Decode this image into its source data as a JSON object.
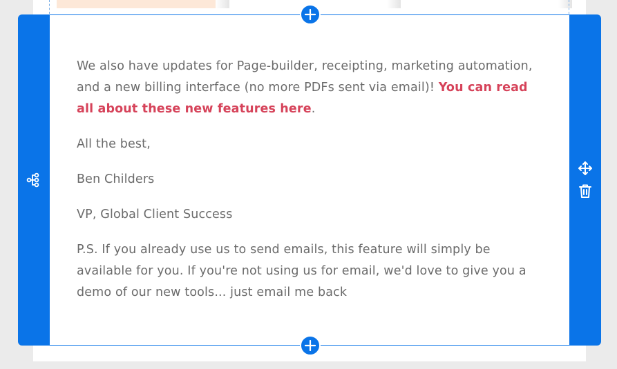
{
  "email_body": {
    "paragraph_updates": {
      "text": "We also have updates for Page-builder, receipting, marketing automation, and a new billing interface (no more PDFs sent via email)! ",
      "link_text": "You can read all about these new features here",
      "suffix": "."
    },
    "sign_off": "All the best,",
    "signer_name": "Ben Childers",
    "signer_title": "VP, Global Client Success",
    "postscript": "P.S. If you already use us to send emails, this feature will simply be available for you. If you're not using us for email, we'd love to give you a demo of our new tools... just email me back"
  },
  "toolbar": {
    "left_icon": "structure-tree-icon",
    "right_icons": [
      "move-arrows-icon",
      "trash-icon"
    ],
    "add_icon": "plus-icon"
  },
  "colors": {
    "selection_blue": "#0a74e8",
    "link_red": "#d6435a",
    "body_text": "#6b6b6b",
    "canvas_bg": "#ebebeb",
    "image_peach": "#fde8d8"
  }
}
